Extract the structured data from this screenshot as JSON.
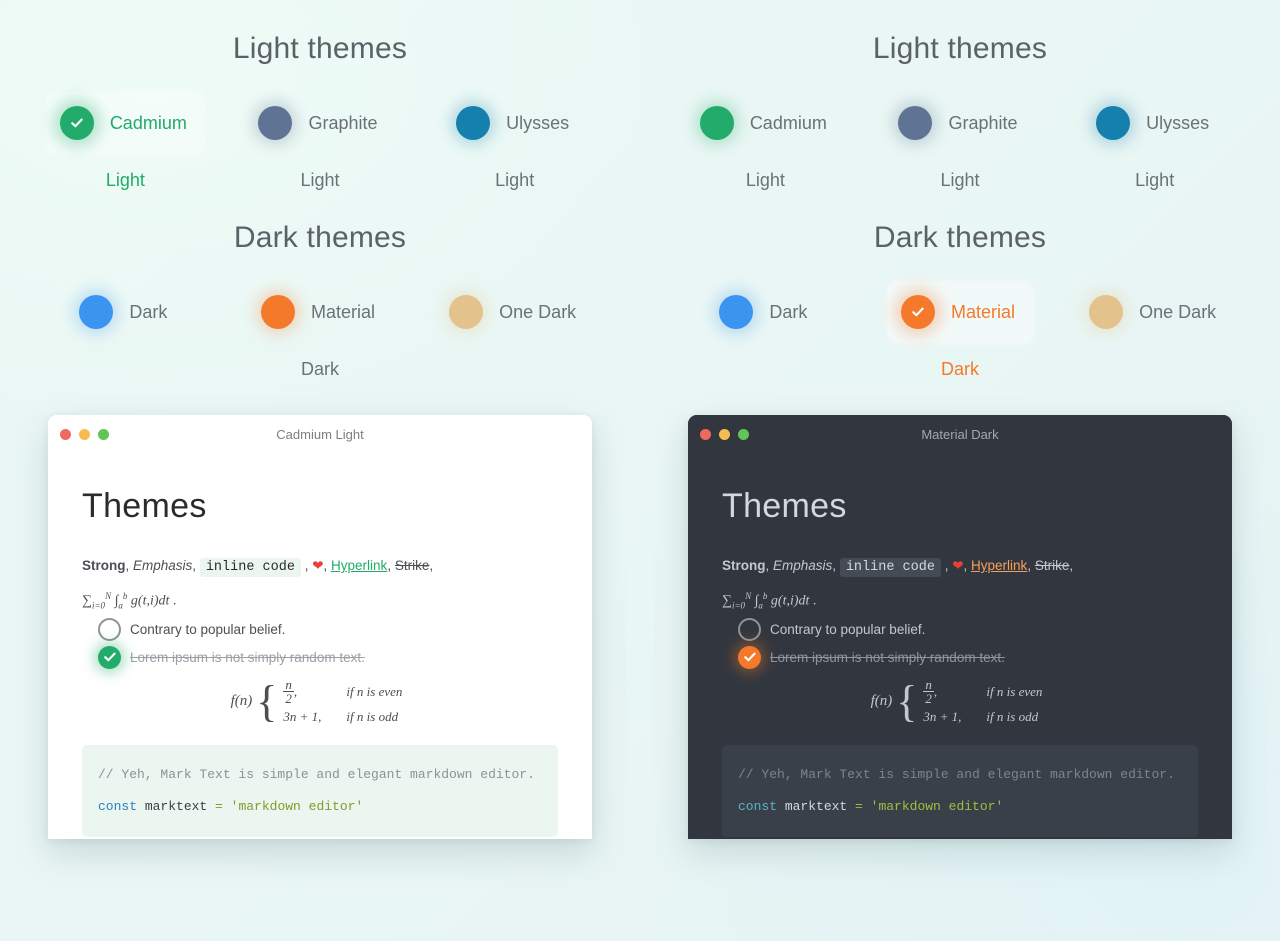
{
  "background_color": "#eaf7f4",
  "panels": [
    {
      "name": "left-panel",
      "light_section": {
        "title": "Light themes",
        "themes": [
          {
            "name": "Cadmium",
            "sub": "Light",
            "color": "#22ab6a",
            "selected": true
          },
          {
            "name": "Graphite",
            "sub": "Light",
            "color": "#5f7494",
            "selected": false
          },
          {
            "name": "Ulysses",
            "sub": "Light",
            "color": "#1580ad",
            "selected": false
          }
        ]
      },
      "dark_section": {
        "title": "Dark themes",
        "themes": [
          {
            "name": "Dark",
            "sub": "",
            "color": "#3d93f0",
            "selected": false
          },
          {
            "name": "Material",
            "sub": "Dark",
            "color": "#f5792a",
            "selected": false
          },
          {
            "name": "One Dark",
            "sub": "",
            "color": "#e3c28c",
            "selected": false
          }
        ]
      },
      "window": {
        "title": "Cadmium Light",
        "mode": "light",
        "traffic_lights": [
          "#ee6a5f",
          "#f5bd4f",
          "#61c454"
        ],
        "colors": {
          "chrome": "#ffffff",
          "body": "#ffffff",
          "title_text": "#7b8085",
          "heading": "#2b2b2b",
          "text": "#4a4f54",
          "muted": "#9aa0a5",
          "inline_code_bg": "#ecf6f0",
          "inline_code_text": "#2b2b2b",
          "link": "#22ab6a",
          "accent": "#22ab6a",
          "heart": "#e8413a",
          "codeblock_bg": "#eaf6ef",
          "code_comment": "#8a9399",
          "code_keyword": "#2a7fc4",
          "code_string": "#879a2b",
          "code_plain": "#3a3f44",
          "tail_bg": "#eef7f2"
        },
        "heading": "Themes",
        "inline": {
          "strong": "Strong",
          "sep1": ", ",
          "emphasis": "Emphasis",
          "sep2": ", ",
          "code": "inline code",
          "sep3": " , ",
          "heart": "❤",
          "sep4": ", ",
          "link": "Hyperlink",
          "sep5": ", ",
          "strike": "Strike",
          "sep6": ","
        },
        "math_inline": "∑ i=0 N ∫ a b g(t,i)dt .",
        "todo": [
          {
            "text": "Contrary to popular belief.",
            "done": false
          },
          {
            "text": "Lorem ipsum is not simply random text.",
            "done": true
          }
        ],
        "formula": {
          "lhs": "f(n)",
          "cases": [
            {
              "value_num": "n",
              "value_den": "2",
              "value_suffix": ",",
              "condition": "if n is even"
            },
            {
              "value_plain": "3n + 1,",
              "condition": "if n is odd"
            }
          ]
        },
        "code": {
          "comment": "// Yeh, Mark Text is simple and elegant markdown editor.",
          "keyword": "const",
          "name": " marktext ",
          "operator": "=",
          "string": " 'markdown editor'"
        }
      }
    },
    {
      "name": "right-panel",
      "light_section": {
        "title": "Light themes",
        "themes": [
          {
            "name": "Cadmium",
            "sub": "Light",
            "color": "#22ab6a",
            "selected": false
          },
          {
            "name": "Graphite",
            "sub": "Light",
            "color": "#5f7494",
            "selected": false
          },
          {
            "name": "Ulysses",
            "sub": "Light",
            "color": "#1580ad",
            "selected": false
          }
        ]
      },
      "dark_section": {
        "title": "Dark themes",
        "themes": [
          {
            "name": "Dark",
            "sub": "",
            "color": "#3d93f0",
            "selected": false
          },
          {
            "name": "Material",
            "sub": "Dark",
            "color": "#f5792a",
            "selected": true
          },
          {
            "name": "One Dark",
            "sub": "",
            "color": "#e3c28c",
            "selected": false
          }
        ]
      },
      "window": {
        "title": "Material Dark",
        "mode": "dark",
        "traffic_lights": [
          "#ee6a5f",
          "#f5bd4f",
          "#61c454"
        ],
        "colors": {
          "chrome": "#32373f",
          "body": "#32373f",
          "title_text": "#a2a8b0",
          "heading": "#d3d8de",
          "text": "#c2c8cf",
          "muted": "#8e959d",
          "inline_code_bg": "#454b55",
          "inline_code_text": "#d3d8de",
          "link": "#f5a05a",
          "accent": "#f5792a",
          "heart": "#e8413a",
          "codeblock_bg": "#3a4049",
          "code_comment": "#7d848c",
          "code_keyword": "#56b6c2",
          "code_string": "#99c140",
          "code_plain": "#d3d8de",
          "tail_bg": "#3a4049"
        },
        "heading": "Themes",
        "inline": {
          "strong": "Strong",
          "sep1": ", ",
          "emphasis": "Emphasis",
          "sep2": ", ",
          "code": "inline code",
          "sep3": " , ",
          "heart": "❤",
          "sep4": ", ",
          "link": "Hyperlink",
          "sep5": ", ",
          "strike": "Strike",
          "sep6": ","
        },
        "math_inline": "∑ i=0 N ∫ a b g(t,i)dt .",
        "todo": [
          {
            "text": "Contrary to popular belief.",
            "done": false
          },
          {
            "text": "Lorem ipsum is not simply random text.",
            "done": true
          }
        ],
        "formula": {
          "lhs": "f(n)",
          "cases": [
            {
              "value_num": "n",
              "value_den": "2",
              "value_suffix": ",",
              "condition": "if n is even"
            },
            {
              "value_plain": "3n + 1,",
              "condition": "if n is odd"
            }
          ]
        },
        "code": {
          "comment": "// Yeh, Mark Text is simple and elegant markdown editor.",
          "keyword": "const",
          "name": " marktext ",
          "operator": "=",
          "string": " 'markdown editor'"
        }
      }
    }
  ]
}
